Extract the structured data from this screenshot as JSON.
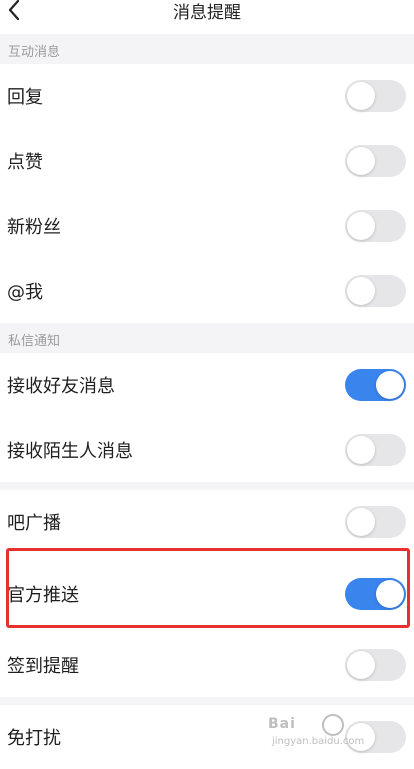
{
  "nav": {
    "title": "消息提醒"
  },
  "sections": {
    "interaction": "互动消息",
    "private": "私信通知"
  },
  "settings": {
    "reply": {
      "label": "回复",
      "enabled": false
    },
    "like": {
      "label": "点赞",
      "enabled": false
    },
    "new_fans": {
      "label": "新粉丝",
      "enabled": false
    },
    "mention": {
      "label": "@我",
      "enabled": false
    },
    "friend_msg": {
      "label": "接收好友消息",
      "enabled": true
    },
    "stranger_msg": {
      "label": "接收陌生人消息",
      "enabled": false
    },
    "bar_broadcast": {
      "label": "吧广播",
      "enabled": false
    },
    "official_push": {
      "label": "官方推送",
      "enabled": true
    },
    "checkin_reminder": {
      "label": "签到提醒",
      "enabled": false
    },
    "do_not_disturb": {
      "label": "免打扰",
      "enabled": false
    }
  },
  "colors": {
    "toggle_on": "#3a84ee",
    "toggle_off": "#e6e6e8",
    "highlight_box": "#e8312e"
  },
  "icons": {
    "back": "chevron-left-icon"
  },
  "watermark": {
    "brand": "Bai",
    "site": "jingyan.baidu.com"
  }
}
